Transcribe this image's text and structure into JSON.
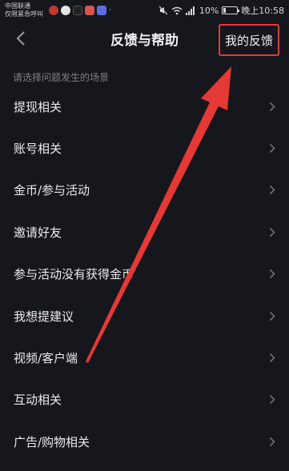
{
  "status_bar": {
    "carrier_line1": "中国联通",
    "carrier_line2": "仅限紧急呼叫",
    "battery": "10%",
    "time": "晚上10:58"
  },
  "nav": {
    "title": "反馈与帮助",
    "my_feedback": "我的反馈"
  },
  "hint": "请选择问题发生的场景",
  "items": [
    {
      "label": "提现相关"
    },
    {
      "label": "账号相关"
    },
    {
      "label": "金币/参与活动"
    },
    {
      "label": "邀请好友"
    },
    {
      "label": "参与活动没有获得金币"
    },
    {
      "label": "我想提建议"
    },
    {
      "label": "视频/客户端"
    },
    {
      "label": "互动相关"
    },
    {
      "label": "广告/购物相关"
    }
  ],
  "colors": {
    "background": "#16161d",
    "annotation_red": "#e53935"
  }
}
